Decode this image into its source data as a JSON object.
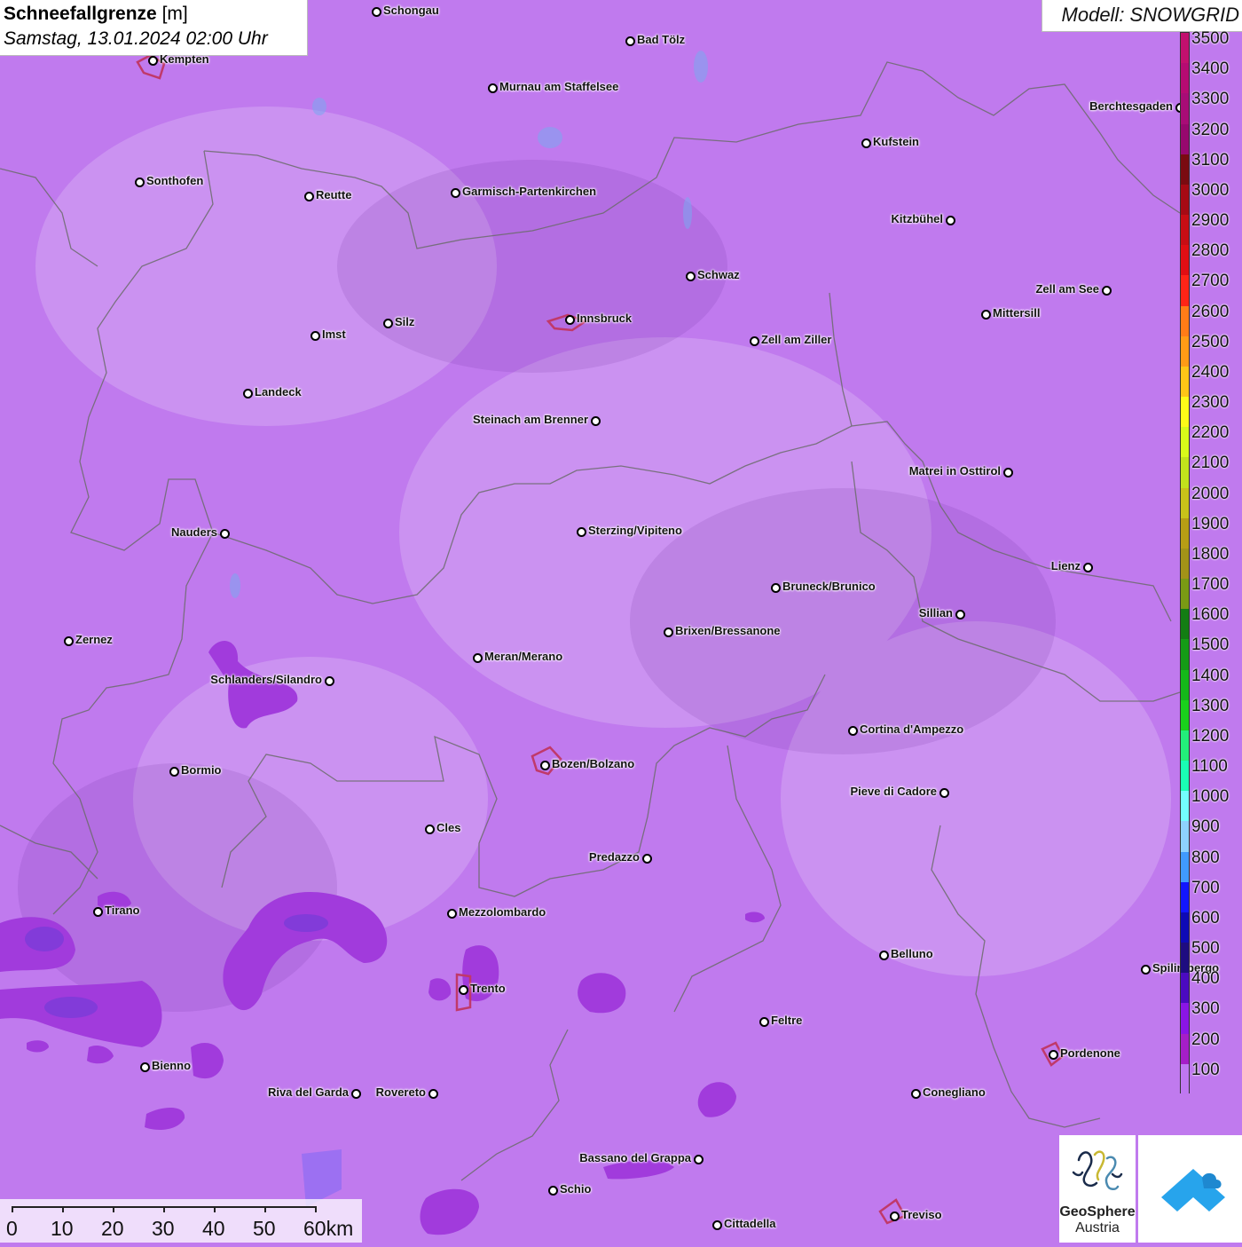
{
  "header": {
    "title_bold": "Schneefallgrenze",
    "title_unit": "[m]",
    "datetime": "Samstag, 13.01.2024 02:00 Uhr",
    "model": "Modell: SNOWGRID"
  },
  "colors": {
    "background_snowline": "#c07aee",
    "low_snowline_patch": "#a13bdc",
    "very_low_patch": "#7d3bd8",
    "border_line": "#6b6b6b"
  },
  "legend": {
    "unit": "m",
    "ticks": [
      "3500",
      "3400",
      "3300",
      "3200",
      "3100",
      "3000",
      "2900",
      "2800",
      "2700",
      "2600",
      "2500",
      "2400",
      "2300",
      "2200",
      "2100",
      "2000",
      "1900",
      "1800",
      "1700",
      "1600",
      "1500",
      "1400",
      "1300",
      "1200",
      "1100",
      "1000",
      "900",
      "800",
      "700",
      "600",
      "500",
      "400",
      "300",
      "200",
      "100"
    ],
    "colors": [
      "#c2106e",
      "#b60b72",
      "#a80c76",
      "#97086e",
      "#7a0b11",
      "#a60a14",
      "#c80d14",
      "#e00e13",
      "#fe2417",
      "#ff7c17",
      "#ff9b16",
      "#fec617",
      "#fefb18",
      "#d9fa1a",
      "#c2e21c",
      "#c9c21a",
      "#b79d15",
      "#a29318",
      "#7a9a14",
      "#137d13",
      "#159b17",
      "#15b81a",
      "#1ad01c",
      "#23ef7a",
      "#1afeb4",
      "#73feff",
      "#8ed2ff",
      "#409aff",
      "#1216ff",
      "#0e0ab5",
      "#1e0c80",
      "#4b0ac0",
      "#8a15e6",
      "#a51ec8",
      "#bf77f2"
    ]
  },
  "scale": {
    "ticks": [
      "0",
      "10",
      "20",
      "30",
      "40",
      "50",
      "60km"
    ]
  },
  "logos": {
    "geosphere_line1": "GeoSphere",
    "geosphere_line2": "Austria"
  },
  "cities": [
    {
      "name": "Schongau",
      "side": "right"
    },
    {
      "name": "Bad Tölz",
      "side": "right"
    },
    {
      "name": "Kempten",
      "side": "right"
    },
    {
      "name": "Murnau am Staffelsee",
      "side": "right"
    },
    {
      "name": "Berchtesgaden",
      "side": "left"
    },
    {
      "name": "Kufstein",
      "side": "right"
    },
    {
      "name": "Sonthofen",
      "side": "right"
    },
    {
      "name": "Reutte",
      "side": "right"
    },
    {
      "name": "Garmisch-Partenkirchen",
      "side": "right"
    },
    {
      "name": "Kitzbühel",
      "side": "left"
    },
    {
      "name": "Schwaz",
      "side": "right"
    },
    {
      "name": "Zell am See",
      "side": "left"
    },
    {
      "name": "Innsbruck",
      "side": "right"
    },
    {
      "name": "Mittersill",
      "side": "right"
    },
    {
      "name": "Imst",
      "side": "right"
    },
    {
      "name": "Silz",
      "side": "right"
    },
    {
      "name": "Zell am Ziller",
      "side": "right"
    },
    {
      "name": "Landeck",
      "side": "right"
    },
    {
      "name": "Steinach am Brenner",
      "side": "left"
    },
    {
      "name": "Matrei in Osttirol",
      "side": "left"
    },
    {
      "name": "Nauders",
      "side": "left"
    },
    {
      "name": "Sterzing/Vipiteno",
      "side": "right"
    },
    {
      "name": "Lienz",
      "side": "left"
    },
    {
      "name": "Bruneck/Brunico",
      "side": "right"
    },
    {
      "name": "Sillian",
      "side": "left"
    },
    {
      "name": "Zernez",
      "side": "right"
    },
    {
      "name": "Brixen/Bressanone",
      "side": "right"
    },
    {
      "name": "Meran/Merano",
      "side": "right"
    },
    {
      "name": "Schlanders/Silandro",
      "side": "left"
    },
    {
      "name": "Cortina d'Ampezzo",
      "side": "right"
    },
    {
      "name": "Bozen/Bolzano",
      "side": "right"
    },
    {
      "name": "Bormio",
      "side": "right"
    },
    {
      "name": "Pieve di Cadore",
      "side": "left"
    },
    {
      "name": "Cles",
      "side": "right"
    },
    {
      "name": "Predazzo",
      "side": "left"
    },
    {
      "name": "Tirano",
      "side": "right"
    },
    {
      "name": "Mezzolombardo",
      "side": "right"
    },
    {
      "name": "Belluno",
      "side": "right"
    },
    {
      "name": "Spilimbergo",
      "side": "right"
    },
    {
      "name": "Trento",
      "side": "right"
    },
    {
      "name": "Feltre",
      "side": "right"
    },
    {
      "name": "Pordenone",
      "side": "right"
    },
    {
      "name": "Bienno",
      "side": "right"
    },
    {
      "name": "Riva del Garda",
      "side": "left"
    },
    {
      "name": "Rovereto",
      "side": "left"
    },
    {
      "name": "Conegliano",
      "side": "right"
    },
    {
      "name": "Bassano del Grappa",
      "side": "left"
    },
    {
      "name": "Schio",
      "side": "right"
    },
    {
      "name": "Treviso",
      "side": "right"
    },
    {
      "name": "Cittadella",
      "side": "right"
    }
  ]
}
